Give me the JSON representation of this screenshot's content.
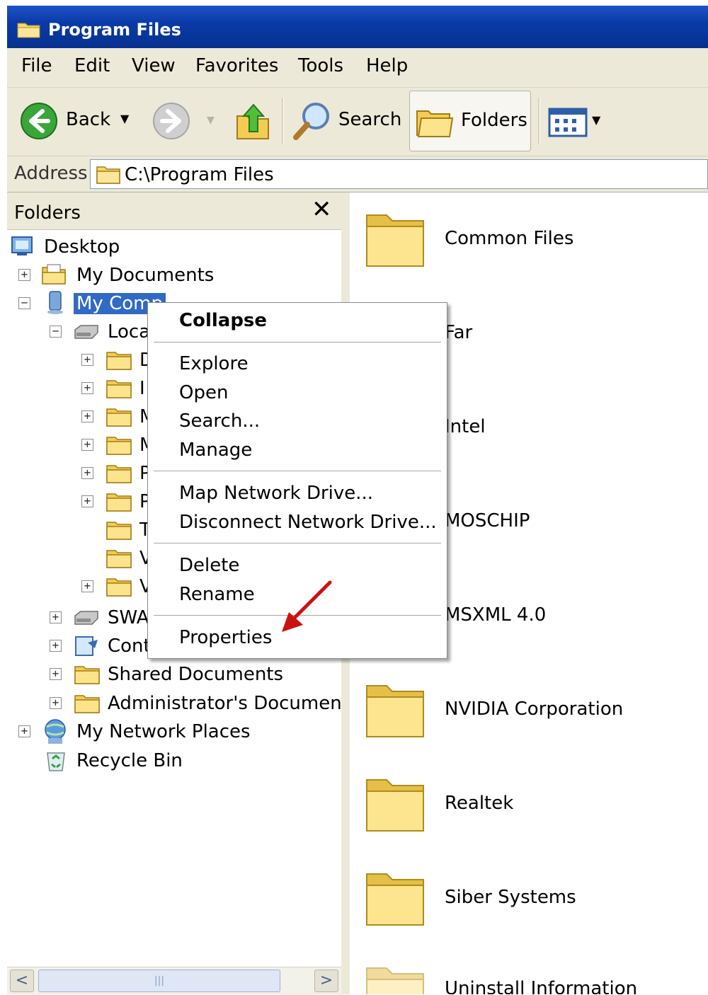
{
  "window": {
    "title": "Program Files"
  },
  "menu": [
    "File",
    "Edit",
    "View",
    "Favorites",
    "Tools",
    "Help"
  ],
  "toolbar": {
    "back": "Back",
    "search": "Search",
    "folders": "Folders"
  },
  "address": {
    "label": "Address",
    "value": "C:\\Program Files"
  },
  "folders_pane": {
    "title": "Folders",
    "close": "✕",
    "tree": [
      {
        "label": "Desktop"
      },
      {
        "label": "My Documents",
        "expander": "+"
      },
      {
        "label": "My Comp",
        "expander": "−"
      },
      {
        "label": "Loca",
        "expander": "−"
      },
      {
        "label": "D",
        "expander": "+"
      },
      {
        "label": "I",
        "expander": "+"
      },
      {
        "label": "M",
        "expander": "+"
      },
      {
        "label": "M",
        "expander": "+"
      },
      {
        "label": "P",
        "expander": "+"
      },
      {
        "label": "P",
        "expander": "+"
      },
      {
        "label": "T"
      },
      {
        "label": "V"
      },
      {
        "label": "V",
        "expander": "+"
      },
      {
        "label": "SWA",
        "expander": "+"
      },
      {
        "label": "Cont",
        "expander": "+"
      },
      {
        "label": "Shared Documents",
        "expander": "+"
      },
      {
        "label": "Administrator's Documents",
        "expander": "+"
      },
      {
        "label": "My Network Places",
        "expander": "+"
      },
      {
        "label": "Recycle Bin"
      }
    ]
  },
  "scrollbar": {
    "left": "<",
    "right": ">",
    "grip": "|||"
  },
  "files": [
    "Common Files",
    "Far",
    "Intel",
    "MOSCHIP",
    "MSXML 4.0",
    "NVIDIA Corporation",
    "Realtek",
    "Siber Systems",
    "Uninstall Information"
  ],
  "context_menu": {
    "items": [
      "Collapse",
      "Explore",
      "Open",
      "Search...",
      "Manage",
      "Map Network Drive...",
      "Disconnect Network Drive...",
      "Delete",
      "Rename",
      "Properties"
    ]
  },
  "colors": {
    "title_bar": "#0a3aa8",
    "selection": "#316ac5",
    "folder": "#f5d770",
    "annotation_arrow": "#cc1111"
  }
}
